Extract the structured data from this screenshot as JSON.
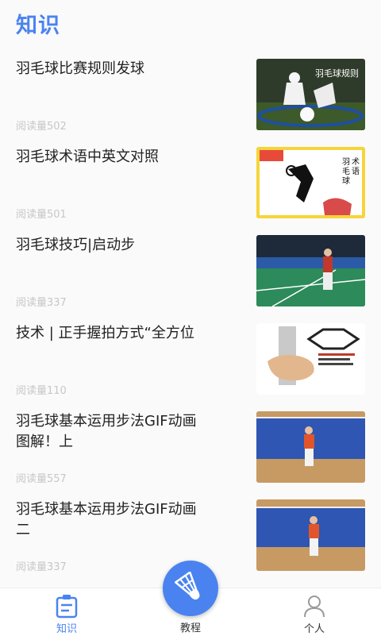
{
  "header": {
    "title": "知识"
  },
  "articles": [
    {
      "title": "羽毛球比赛规则发球",
      "reads": "阅读量502",
      "thumb_caption": "羽毛球规则"
    },
    {
      "title": "羽毛球术语中英文对照",
      "reads": "阅读量501",
      "thumb_caption": "羽毛球术语"
    },
    {
      "title": "羽毛球技巧|启动步",
      "reads": "阅读量337"
    },
    {
      "title": "技术 | 正手握拍方式“全方位",
      "reads": "阅读量110"
    },
    {
      "title": "羽毛球基本运用步法GIF动画图解！上",
      "reads": "阅读量557"
    },
    {
      "title": "羽毛球基本运用步法GIF动画二",
      "reads": "阅读量337"
    }
  ],
  "nav": {
    "knowledge": "知识",
    "tutorial": "教程",
    "profile": "个人"
  },
  "colors": {
    "accent": "#4a83f0",
    "muted": "#c7c7c7"
  }
}
